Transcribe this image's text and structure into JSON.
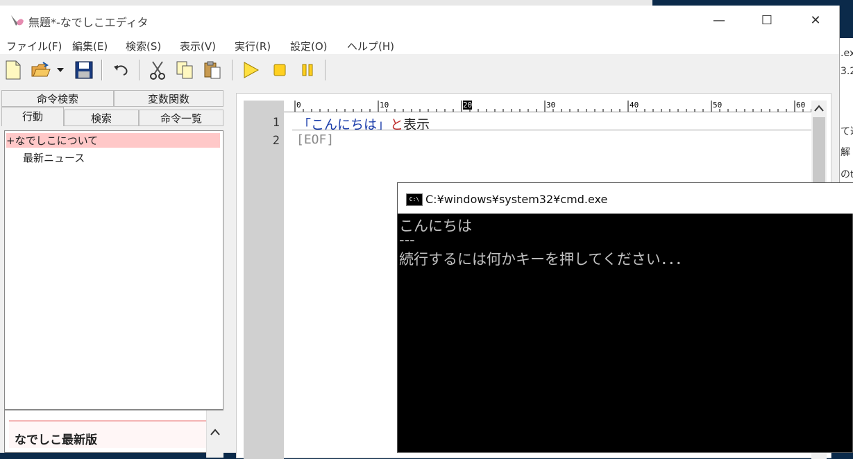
{
  "window": {
    "title": "無題*-なでしこエディタ",
    "controls": {
      "minimize": "—",
      "maximize": "☐",
      "close": "✕"
    }
  },
  "menu": [
    "ファイル(F)",
    "編集(E)",
    "検索(S)",
    "表示(V)",
    "実行(R)",
    "設定(O)",
    "ヘルプ(H)"
  ],
  "toolbar": {
    "icons": [
      "new-file-icon",
      "open-folder-icon",
      "dropdown-arrow-icon",
      "save-icon",
      "undo-icon",
      "cut-icon",
      "copy-icon",
      "paste-icon",
      "run-icon",
      "stop-icon",
      "pause-icon"
    ]
  },
  "left_panel": {
    "tabs_top": [
      "命令検索",
      "変数関数"
    ],
    "tabs_bottom": [
      "行動",
      "検索",
      "命令一覧"
    ],
    "tree": [
      "+なでしこについて",
      "最新ニュース"
    ],
    "news_title": "なでしこ最新版"
  },
  "editor": {
    "ruler_marks": [
      "0",
      "10",
      "20",
      "30",
      "40",
      "50",
      "60"
    ],
    "line_numbers": [
      "1",
      "2"
    ],
    "line1": {
      "string": "「こんにちは」",
      "particle": "と",
      "command": "表示"
    },
    "line2": "[EOF]",
    "colors": {
      "string": "#1a3caa",
      "particle": "#c03030",
      "command": "#222222",
      "eof": "#888888"
    }
  },
  "cmd": {
    "title": "C:¥windows¥system32¥cmd.exe",
    "icon_label": "C:\\",
    "lines": [
      "こんにちは",
      "---",
      "続行するには何かキーを押してください．．．"
    ]
  },
  "background_window": {
    "fragments": [
      ".ex",
      "3.2",
      "て運",
      "解",
      "のt"
    ]
  }
}
